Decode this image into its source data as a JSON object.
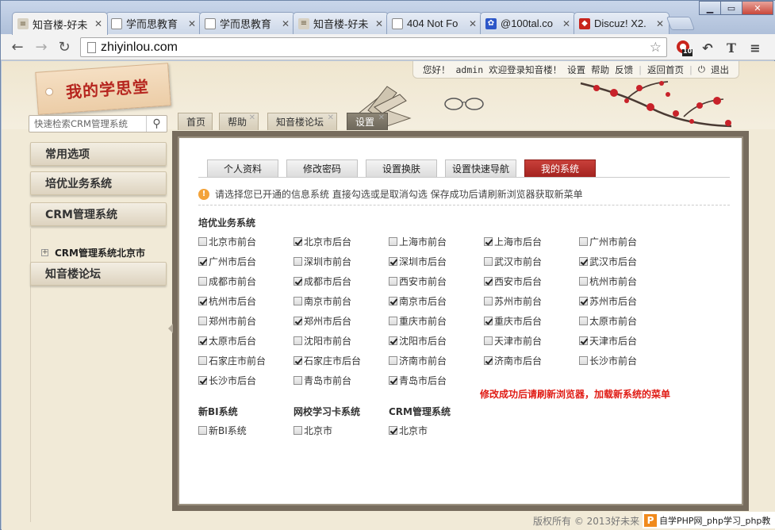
{
  "browser": {
    "tabs": [
      {
        "title": "知音楼-好未",
        "icon": "stack-icon",
        "active": true
      },
      {
        "title": "学而思教育",
        "icon": "page-icon",
        "active": false
      },
      {
        "title": "学而思教育",
        "icon": "page-icon",
        "active": false
      },
      {
        "title": "知音楼-好未",
        "icon": "stack-icon",
        "active": false
      },
      {
        "title": "404 Not Fo",
        "icon": "page-icon",
        "active": false
      },
      {
        "title": "@100tal.co",
        "icon": "paw-icon",
        "active": false
      },
      {
        "title": "Discuz! X2.",
        "icon": "discuz-icon",
        "active": false
      }
    ],
    "url": "zhiyinlou.com",
    "ext_badge": "10"
  },
  "header": {
    "logo_text": "我的学思堂",
    "userbar": {
      "greeting": "您好！",
      "username": "admin",
      "welcome": "欢迎登录知音楼！",
      "settings": "设置",
      "help": "帮助",
      "feedback": "反馈",
      "home": "返回首页",
      "logout": "退出"
    },
    "search_placeholder": "快速检索CRM管理系统",
    "nav_tabs": [
      {
        "label": "首页",
        "active": false
      },
      {
        "label": "帮助",
        "active": false
      },
      {
        "label": "知音楼论坛",
        "active": false
      },
      {
        "label": "设置",
        "active": true
      }
    ]
  },
  "sidebar": {
    "items": [
      "常用选项",
      "培优业务系统",
      "CRM管理系统",
      "知音楼论坛"
    ],
    "tree_item": "CRM管理系统北京市"
  },
  "content": {
    "subtabs": [
      {
        "label": "个人资料",
        "active": false
      },
      {
        "label": "修改密码",
        "active": false
      },
      {
        "label": "设置换肤",
        "active": false
      },
      {
        "label": "设置快速导航",
        "active": false
      },
      {
        "label": "我的系统",
        "active": true
      }
    ],
    "notice": "请选择您已开通的信息系统 直接勾选或是取消勾选 保存成功后请刷新浏览器获取新菜单",
    "group_peiyou": {
      "title": "培优业务系统",
      "options": [
        {
          "label": "北京市前台",
          "checked": false
        },
        {
          "label": "北京市后台",
          "checked": true
        },
        {
          "label": "上海市前台",
          "checked": false
        },
        {
          "label": "上海市后台",
          "checked": true
        },
        {
          "label": "广州市前台",
          "checked": false
        },
        {
          "label": "广州市后台",
          "checked": true
        },
        {
          "label": "深圳市前台",
          "checked": false
        },
        {
          "label": "深圳市后台",
          "checked": true
        },
        {
          "label": "武汉市前台",
          "checked": false
        },
        {
          "label": "武汉市后台",
          "checked": true
        },
        {
          "label": "成都市前台",
          "checked": false
        },
        {
          "label": "成都市后台",
          "checked": true
        },
        {
          "label": "西安市前台",
          "checked": false
        },
        {
          "label": "西安市后台",
          "checked": true
        },
        {
          "label": "杭州市前台",
          "checked": false
        },
        {
          "label": "杭州市后台",
          "checked": true
        },
        {
          "label": "南京市前台",
          "checked": false
        },
        {
          "label": "南京市后台",
          "checked": true
        },
        {
          "label": "苏州市前台",
          "checked": false
        },
        {
          "label": "苏州市后台",
          "checked": true
        },
        {
          "label": "郑州市前台",
          "checked": false
        },
        {
          "label": "郑州市后台",
          "checked": true
        },
        {
          "label": "重庆市前台",
          "checked": false
        },
        {
          "label": "重庆市后台",
          "checked": true
        },
        {
          "label": "太原市前台",
          "checked": false
        },
        {
          "label": "太原市后台",
          "checked": true
        },
        {
          "label": "沈阳市前台",
          "checked": false
        },
        {
          "label": "沈阳市后台",
          "checked": true
        },
        {
          "label": "天津市前台",
          "checked": false
        },
        {
          "label": "天津市后台",
          "checked": true
        },
        {
          "label": "石家庄市前台",
          "checked": false
        },
        {
          "label": "石家庄市后台",
          "checked": true
        },
        {
          "label": "济南市前台",
          "checked": false
        },
        {
          "label": "济南市后台",
          "checked": true
        },
        {
          "label": "长沙市前台",
          "checked": false
        },
        {
          "label": "长沙市后台",
          "checked": true
        },
        {
          "label": "青岛市前台",
          "checked": false
        },
        {
          "label": "青岛市后台",
          "checked": true
        }
      ]
    },
    "group_bi": {
      "title": "新BI系统",
      "option": {
        "label": "新BI系统",
        "checked": false
      }
    },
    "group_card": {
      "title": "网校学习卡系统",
      "option": {
        "label": "北京市",
        "checked": false
      }
    },
    "group_crm": {
      "title": "CRM管理系统",
      "option": {
        "label": "北京市",
        "checked": true
      }
    },
    "success_msg": "修改成功后请刷新浏览器，加载新系统的菜单"
  },
  "footer": {
    "copyright": "版权所有 © 2013好未来",
    "watermark": "自学PHP网_php学习_php教"
  }
}
